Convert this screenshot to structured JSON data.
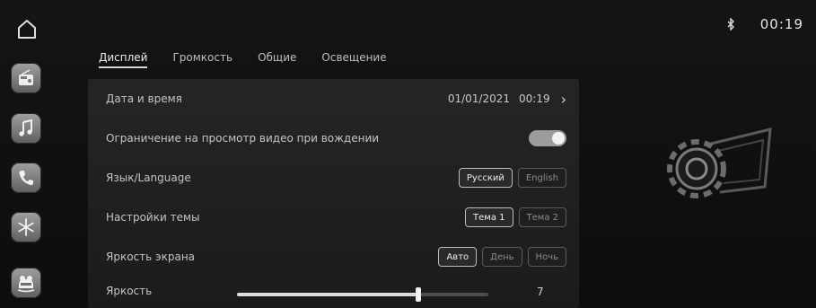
{
  "status": {
    "clock": "00:19"
  },
  "tabs": [
    {
      "label": "Дисплей",
      "active": true
    },
    {
      "label": "Громкость",
      "active": false
    },
    {
      "label": "Общие",
      "active": false
    },
    {
      "label": "Освещение",
      "active": false
    }
  ],
  "settings": {
    "datetime": {
      "label": "Дата и время",
      "date": "01/01/2021",
      "time": "00:19"
    },
    "video_limit": {
      "label": "Ограничение на просмотр видео при вождении",
      "enabled": true
    },
    "language": {
      "label": "Язык/Language",
      "options": [
        "Русский",
        "English"
      ],
      "selected": "Русский"
    },
    "theme": {
      "label": "Настройки темы",
      "options": [
        "Тема 1",
        "Тема 2"
      ],
      "selected": "Тема 1"
    },
    "screen_brightness": {
      "label": "Яркость экрана",
      "options": [
        "Авто",
        "День",
        "Ночь"
      ],
      "selected": "Авто"
    },
    "brightness": {
      "label": "Яркость",
      "value": "7",
      "fraction": 0.72
    }
  },
  "icons": {
    "home": "home-icon",
    "rail": [
      "radio-icon",
      "music-icon",
      "phone-icon",
      "climate-icon",
      "car-settings-icon"
    ],
    "bluetooth": "bluetooth-icon",
    "art": "gear-settings-icon"
  },
  "colors": {
    "background": "#0c0c0c",
    "panel": "#222222",
    "accent": "#dcdcdc"
  }
}
